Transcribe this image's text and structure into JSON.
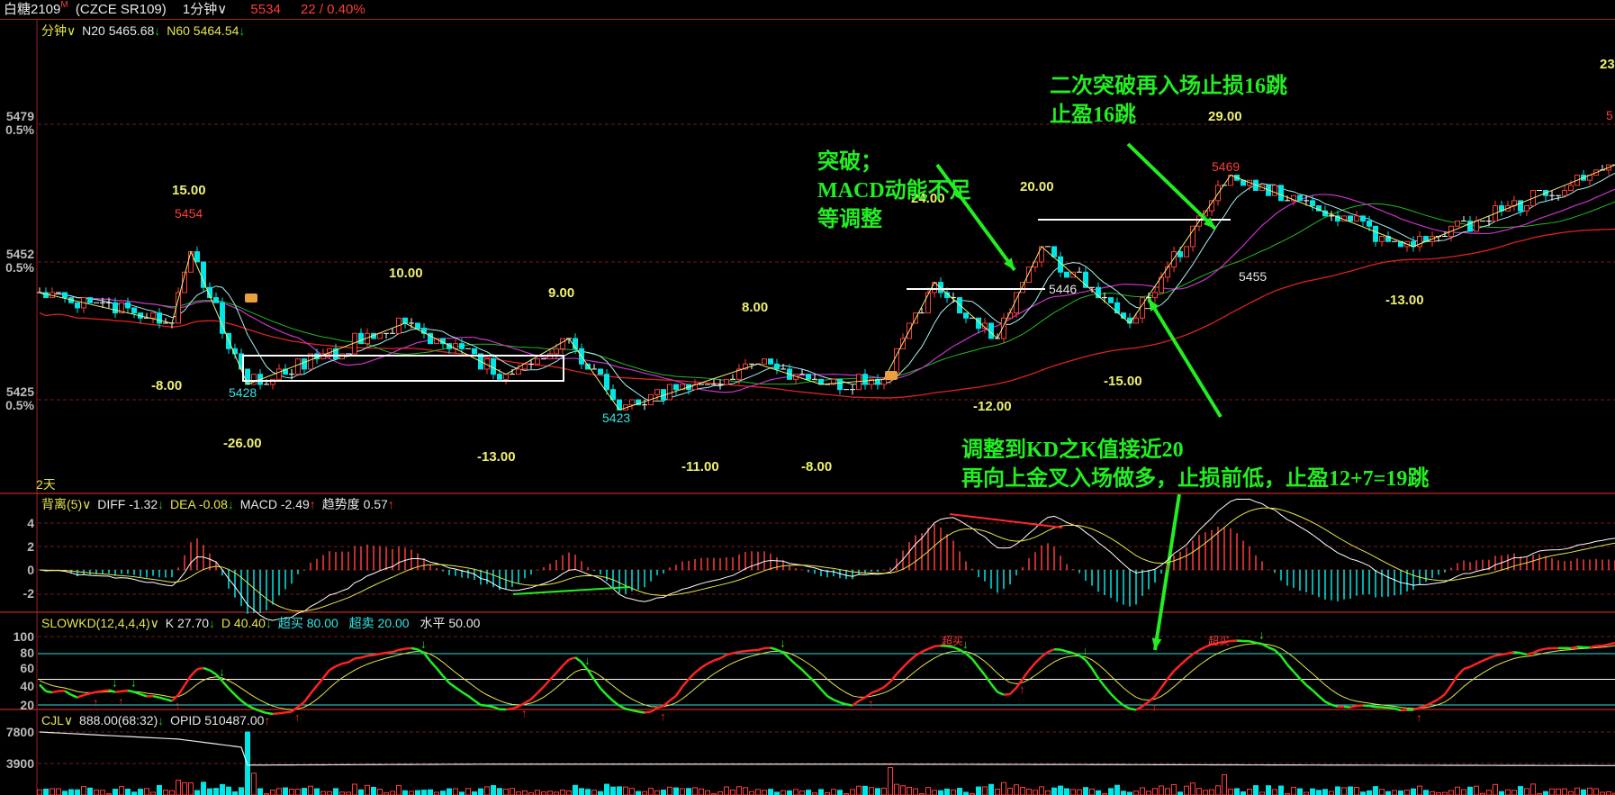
{
  "header": {
    "title": "白糖2109",
    "flag": "M",
    "code": "(CZCE SR109)",
    "period": "1分钟∨",
    "last_price": "5534",
    "change": "22 / 0.40%"
  },
  "main_panel": {
    "label": "分钟∨",
    "n20_label": "N20 5465.68",
    "n20_arrow": "↓",
    "n60_label": "N60 5464.54",
    "n60_arrow": "↓",
    "axis": [
      {
        "price": "5479",
        "pct": "0.5%"
      },
      {
        "price": "5452",
        "pct": "0.5%"
      },
      {
        "price": "5425",
        "pct": "0.5%"
      }
    ],
    "days_label": "2天",
    "zigzag_labels": [
      "15.00",
      "-8.00",
      "10.00",
      "-26.00",
      "9.00",
      "-13.00",
      "8.00",
      "-11.00",
      "-8.00",
      "24.00",
      "20.00",
      "-12.00",
      "29.00",
      "-15.00",
      "-13.00",
      "23"
    ],
    "price_labels": [
      "5454",
      "5428",
      "5423",
      "5469",
      "5446",
      "5455",
      "5"
    ],
    "annotations": {
      "breakout": [
        "突破；",
        "MACD动能不足",
        "等调整"
      ],
      "second_breakout": [
        "二次突破再入场止损16跳",
        "止盈16跳"
      ],
      "kd_entry": [
        "调整到KD之K值接近20",
        "再向上金叉入场做多，止损前低，止盈12+7=19跳"
      ]
    }
  },
  "macd_panel": {
    "label": "背离(5)∨",
    "diff": "DIFF -1.32",
    "diff_arrow": "↓",
    "dea": "DEA -0.08",
    "dea_arrow": "↓",
    "macd": "MACD -2.49",
    "macd_arrow": "↑",
    "trend": "趋势度 0.57",
    "trend_arrow": "↑",
    "axis": [
      "4",
      "2",
      "0",
      "-2"
    ]
  },
  "kd_panel": {
    "label": "SLOWKD(12,4,4,4)∨",
    "k": "K 27.70",
    "k_arrow": "↓",
    "d": "D 40.40",
    "d_arrow": "↓",
    "overbought": "超买 80.00",
    "oversold": "超卖 20.00",
    "level": "水平 50.00",
    "axis": [
      "100",
      "80",
      "60",
      "40",
      "20"
    ],
    "tags": [
      "超买",
      "超买"
    ]
  },
  "cjl_panel": {
    "label": "CJL∨",
    "value": "888.00(68:32)",
    "value_arrow": "↓",
    "opid": "OPID 510487.00",
    "opid_arrow": "↑",
    "axis": [
      "7800",
      "3900"
    ]
  },
  "colors": {
    "up": "#ff3c3c",
    "down": "#00e6e6",
    "frame": "#a02020",
    "note": "#22ee22",
    "zigzag": "#f0f070"
  },
  "chart_data": {
    "type": "candlestick",
    "title": "白糖2109 1分钟",
    "ylim": [
      5418,
      5482
    ],
    "zigzag_pivots": [
      {
        "bar": 0,
        "price": 5446
      },
      {
        "bar": 21,
        "price": 5440
      },
      {
        "bar": 24,
        "price": 5454
      },
      {
        "bar": 33,
        "price": 5428
      },
      {
        "bar": 58,
        "price": 5440
      },
      {
        "bar": 74,
        "price": 5430
      },
      {
        "bar": 84,
        "price": 5437
      },
      {
        "bar": 92,
        "price": 5423
      },
      {
        "bar": 114,
        "price": 5432
      },
      {
        "bar": 124,
        "price": 5428
      },
      {
        "bar": 134,
        "price": 5429
      },
      {
        "bar": 142,
        "price": 5448
      },
      {
        "bar": 152,
        "price": 5437
      },
      {
        "bar": 159,
        "price": 5455
      },
      {
        "bar": 173,
        "price": 5440
      },
      {
        "bar": 189,
        "price": 5469
      },
      {
        "bar": 218,
        "price": 5455
      },
      {
        "bar": 250,
        "price": 5471
      }
    ],
    "levels": {
      "kd_overbought": 80,
      "kd_oversold": 20,
      "kd_level": 50
    },
    "volume_axis": [
      3900,
      7800
    ]
  }
}
